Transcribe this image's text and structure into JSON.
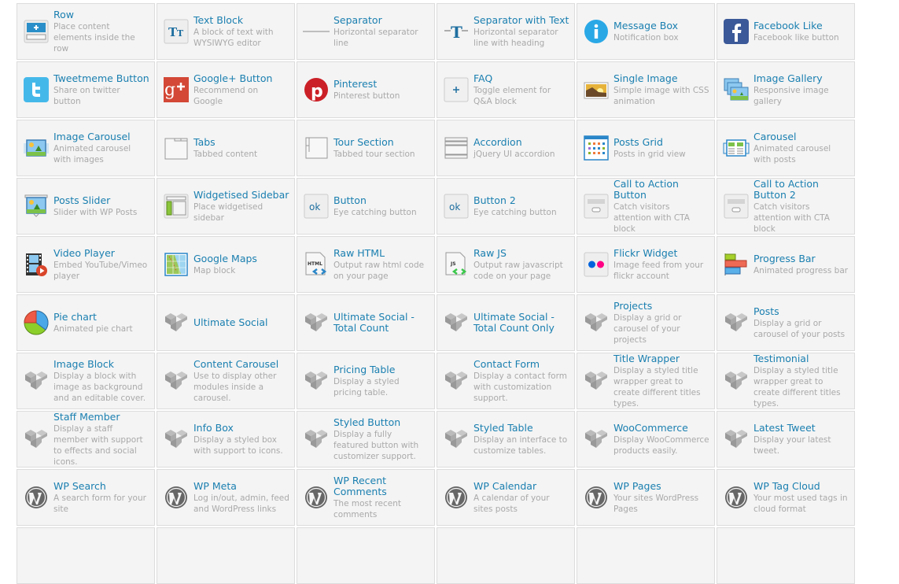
{
  "elements": [
    {
      "title": "Row",
      "desc": "Place content elements inside the row",
      "icon": "row-icon"
    },
    {
      "title": "Text Block",
      "desc": "A block of text with WYSIWYG editor",
      "icon": "text-block-icon"
    },
    {
      "title": "Separator",
      "desc": "Horizontal separator line",
      "icon": "separator-icon"
    },
    {
      "title": "Separator with Text",
      "desc": "Horizontal separator line with heading",
      "icon": "separator-text-icon"
    },
    {
      "title": "Message Box",
      "desc": "Notification box",
      "icon": "info-icon"
    },
    {
      "title": "Facebook Like",
      "desc": "Facebook like button",
      "icon": "facebook-icon"
    },
    {
      "title": "Tweetmeme Button",
      "desc": "Share on twitter button",
      "icon": "twitter-icon"
    },
    {
      "title": "Google+ Button",
      "desc": "Recommend on Google",
      "icon": "google-plus-icon"
    },
    {
      "title": "Pinterest",
      "desc": "Pinterest button",
      "icon": "pinterest-icon"
    },
    {
      "title": "FAQ",
      "desc": "Toggle element for Q&A block",
      "icon": "toggle-plus-icon"
    },
    {
      "title": "Single Image",
      "desc": "Simple image with CSS animation",
      "icon": "single-image-icon"
    },
    {
      "title": "Image Gallery",
      "desc": "Responsive image gallery",
      "icon": "image-gallery-icon"
    },
    {
      "title": "Image Carousel",
      "desc": "Animated carousel with images",
      "icon": "image-carousel-icon"
    },
    {
      "title": "Tabs",
      "desc": "Tabbed content",
      "icon": "tabs-icon"
    },
    {
      "title": "Tour Section",
      "desc": "Tabbed tour section",
      "icon": "tour-icon"
    },
    {
      "title": "Accordion",
      "desc": "jQuery UI accordion",
      "icon": "accordion-icon"
    },
    {
      "title": "Posts Grid",
      "desc": "Posts in grid view",
      "icon": "posts-grid-icon"
    },
    {
      "title": "Carousel",
      "desc": "Animated carousel with posts",
      "icon": "carousel-icon"
    },
    {
      "title": "Posts Slider",
      "desc": "Slider with WP Posts",
      "icon": "posts-slider-icon"
    },
    {
      "title": "Widgetised Sidebar",
      "desc": "Place widgetised sidebar",
      "icon": "sidebar-icon"
    },
    {
      "title": "Button",
      "desc": "Eye catching button",
      "icon": "ok-button-icon"
    },
    {
      "title": "Button 2",
      "desc": "Eye catching button",
      "icon": "ok-button-icon"
    },
    {
      "title": "Call to Action Button",
      "desc": "Catch visitors attention with CTA block",
      "icon": "cta-icon"
    },
    {
      "title": "Call to Action Button 2",
      "desc": "Catch visitors attention with CTA block",
      "icon": "cta-icon"
    },
    {
      "title": "Video Player",
      "desc": "Embed YouTube/Vimeo player",
      "icon": "video-icon"
    },
    {
      "title": "Google Maps",
      "desc": "Map block",
      "icon": "map-icon"
    },
    {
      "title": "Raw HTML",
      "desc": "Output raw html code on your page",
      "icon": "html-file-icon"
    },
    {
      "title": "Raw JS",
      "desc": "Output raw javascript code on your page",
      "icon": "js-file-icon"
    },
    {
      "title": "Flickr Widget",
      "desc": "Image feed from your flickr account",
      "icon": "flickr-icon"
    },
    {
      "title": "Progress Bar",
      "desc": "Animated progress bar",
      "icon": "progress-bar-icon"
    },
    {
      "title": "Pie chart",
      "desc": "Animated pie chart",
      "icon": "pie-chart-icon"
    },
    {
      "title": "Ultimate Social",
      "desc": "",
      "icon": "vc-logo-icon"
    },
    {
      "title": "Ultimate Social - Total Count",
      "desc": "",
      "icon": "vc-logo-icon"
    },
    {
      "title": "Ultimate Social - Total Count Only",
      "desc": "",
      "icon": "vc-logo-icon"
    },
    {
      "title": "Projects",
      "desc": "Display a grid or carousel of your projects",
      "icon": "vc-logo-icon"
    },
    {
      "title": "Posts",
      "desc": "Display a grid or carousel of your posts",
      "icon": "vc-logo-icon"
    },
    {
      "title": "Image Block",
      "desc": "Display a block with image as background and an editable cover.",
      "icon": "vc-logo-icon"
    },
    {
      "title": "Content Carousel",
      "desc": "Use to display other modules inside a carousel.",
      "icon": "vc-logo-icon"
    },
    {
      "title": "Pricing Table",
      "desc": "Display a styled pricing table.",
      "icon": "vc-logo-icon"
    },
    {
      "title": "Contact Form",
      "desc": "Display a contact form with customization support.",
      "icon": "vc-logo-icon"
    },
    {
      "title": "Title Wrapper",
      "desc": "Display a styled title wrapper great to create different titles types.",
      "icon": "vc-logo-icon"
    },
    {
      "title": "Testimonial",
      "desc": "Display a styled title wrapper great to create different titles types.",
      "icon": "vc-logo-icon"
    },
    {
      "title": "Staff Member",
      "desc": "Display a staff member with support to effects and social icons.",
      "icon": "vc-logo-icon"
    },
    {
      "title": "Info Box",
      "desc": "Display a styled box with support to icons.",
      "icon": "vc-logo-icon"
    },
    {
      "title": "Styled Button",
      "desc": "Display a fully featured button with customizer support.",
      "icon": "vc-logo-icon"
    },
    {
      "title": "Styled Table",
      "desc": "Display an interface to customize tables.",
      "icon": "vc-logo-icon"
    },
    {
      "title": "WooCommerce",
      "desc": "Display WooCommerce products easily.",
      "icon": "vc-logo-icon"
    },
    {
      "title": "Latest Tweet",
      "desc": "Display your latest tweet.",
      "icon": "vc-logo-icon"
    },
    {
      "title": "WP Search",
      "desc": "A search form for your site",
      "icon": "wordpress-icon"
    },
    {
      "title": "WP Meta",
      "desc": "Log in/out, admin, feed and WordPress links",
      "icon": "wordpress-icon"
    },
    {
      "title": "WP Recent Comments",
      "desc": "The most recent comments",
      "icon": "wordpress-icon"
    },
    {
      "title": "WP Calendar",
      "desc": "A calendar of your sites posts",
      "icon": "wordpress-icon"
    },
    {
      "title": "WP Pages",
      "desc": "Your sites WordPress Pages",
      "icon": "wordpress-icon"
    },
    {
      "title": "WP Tag Cloud",
      "desc": "Your most used tags in cloud format",
      "icon": "wordpress-icon"
    },
    {
      "title": "",
      "desc": "",
      "icon": ""
    },
    {
      "title": "",
      "desc": "",
      "icon": ""
    },
    {
      "title": "",
      "desc": "",
      "icon": ""
    },
    {
      "title": "",
      "desc": "",
      "icon": ""
    },
    {
      "title": "",
      "desc": "",
      "icon": ""
    },
    {
      "title": "",
      "desc": "",
      "icon": ""
    }
  ],
  "colors": {
    "title": "#1a7fb0",
    "desc": "#a9a9a9",
    "cell_bg": "#f4f4f4",
    "cell_border": "#dcdcdc"
  }
}
